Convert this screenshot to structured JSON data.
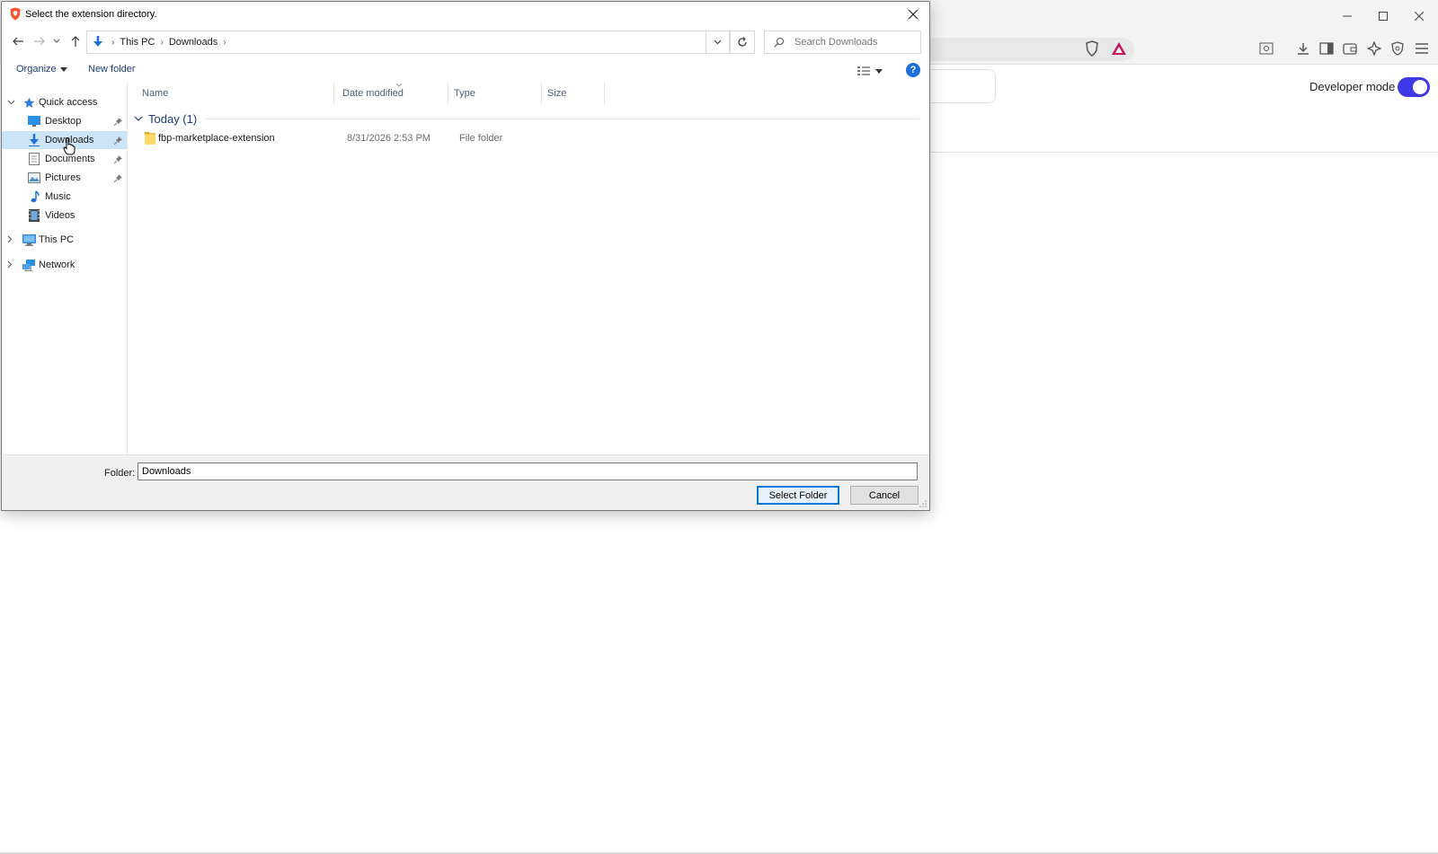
{
  "dialog": {
    "title": "Select the extension directory.",
    "breadcrumb": [
      "This PC",
      "Downloads"
    ],
    "search_placeholder": "Search Downloads",
    "organize_label": "Organize",
    "new_folder_label": "New folder",
    "help_label": "?"
  },
  "nav_pane": {
    "quick_access": "Quick access",
    "items": [
      {
        "label": "Desktop",
        "icon": "desktop-icon",
        "pinned": true
      },
      {
        "label": "Downloads",
        "icon": "downloads-icon",
        "pinned": true,
        "selected": true
      },
      {
        "label": "Documents",
        "icon": "documents-icon",
        "pinned": true
      },
      {
        "label": "Pictures",
        "icon": "pictures-icon",
        "pinned": true
      },
      {
        "label": "Music",
        "icon": "music-icon",
        "pinned": false
      },
      {
        "label": "Videos",
        "icon": "videos-icon",
        "pinned": false
      }
    ],
    "this_pc": "This PC",
    "network": "Network"
  },
  "file_list": {
    "columns": [
      "Name",
      "Date modified",
      "Type",
      "Size"
    ],
    "group_label": "Today (1)",
    "rows": [
      {
        "name": "fbp-marketplace-extension",
        "date": "8/31/2026 2:53 PM",
        "type": "File folder",
        "size": ""
      }
    ]
  },
  "footer": {
    "folder_label": "Folder:",
    "folder_value": "Downloads",
    "select_label": "Select Folder",
    "cancel_label": "Cancel"
  },
  "browser": {
    "developer_mode_label": "Developer mode",
    "developer_mode_on": true,
    "accent_color": "#3f39e8"
  }
}
